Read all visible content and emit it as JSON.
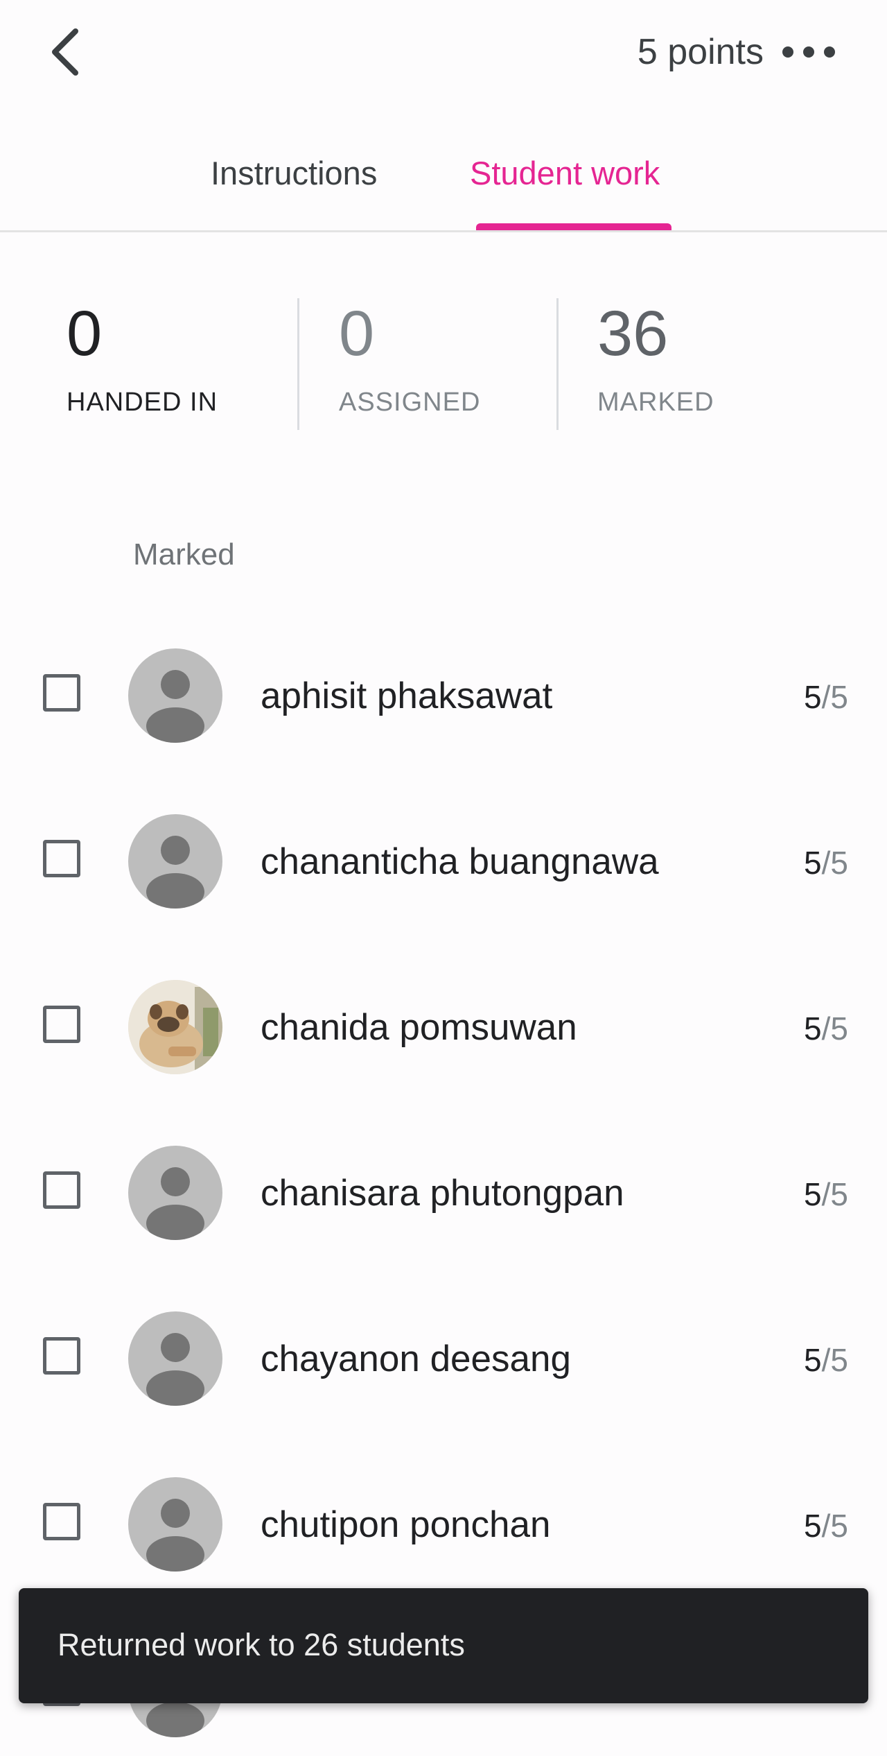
{
  "header": {
    "points_label": "5 points"
  },
  "tabs": [
    {
      "label": "Instructions",
      "active": false
    },
    {
      "label": "Student work",
      "active": true
    }
  ],
  "stats": [
    {
      "value": "0",
      "label": "HANDED IN"
    },
    {
      "value": "0",
      "label": "ASSIGNED"
    },
    {
      "value": "36",
      "label": "MARKED"
    }
  ],
  "section": {
    "title": "Marked"
  },
  "students": [
    {
      "name": "aphisit phaksawat",
      "grade": "5",
      "out_of": "5",
      "avatar": "default-avatar-icon"
    },
    {
      "name": "chananticha buangnawa",
      "grade": "5",
      "out_of": "5",
      "avatar": "default-avatar-icon"
    },
    {
      "name": "chanida pomsuwan",
      "grade": "5",
      "out_of": "5",
      "avatar": "dog-photo"
    },
    {
      "name": "chanisara phutongpan",
      "grade": "5",
      "out_of": "5",
      "avatar": "default-avatar-icon"
    },
    {
      "name": "chayanon deesang",
      "grade": "5",
      "out_of": "5",
      "avatar": "default-avatar-icon"
    },
    {
      "name": "chutipon ponchan",
      "grade": "5",
      "out_of": "5",
      "avatar": "default-avatar-icon"
    }
  ],
  "snackbar": {
    "message": "Returned work to 26 students"
  },
  "colors": {
    "accent": "#e52592",
    "snackbar_bg": "#202124",
    "avatar_bg": "#bdbdbd"
  }
}
